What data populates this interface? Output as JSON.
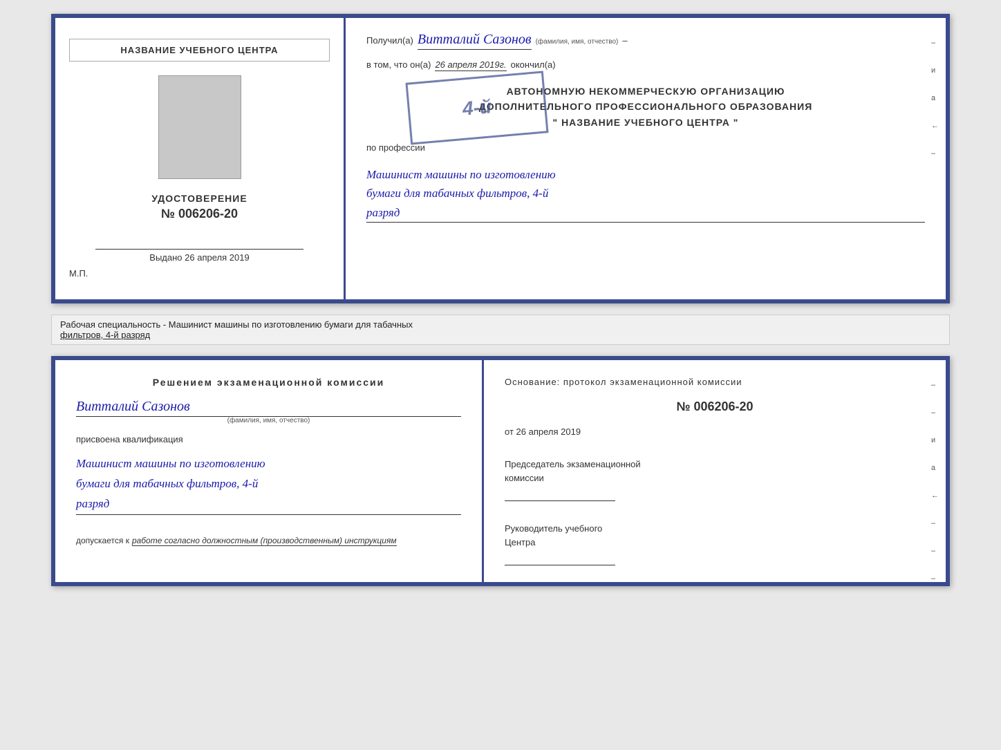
{
  "diploma": {
    "left": {
      "header": "НАЗВАНИЕ УЧЕБНОГО ЦЕНТРА",
      "udost_title": "УДОСТОВЕРЕНИЕ",
      "udost_number": "№ 006206-20",
      "issued_label": "Выдано",
      "issued_date": "26 апреля 2019",
      "mp_label": "М.П."
    },
    "right": {
      "poluchil": "Получил(а)",
      "recipient_name": "Витталий Сазонов",
      "recipient_subtitle": "(фамилия, имя, отчество)",
      "vtom_label": "в том, что он(а)",
      "vtom_date": "26 апреля 2019г.",
      "okonchil": "окончил(а)",
      "org_line1": "АВТОНОМНУЮ НЕКОММЕРЧЕСКУЮ ОРГАНИЗАЦИЮ",
      "org_line2": "ДОПОЛНИТЕЛЬНОГО ПРОФЕССИОНАЛЬНОГО ОБРАЗОВАНИЯ",
      "org_line3": "\" НАЗВАНИЕ УЧЕБНОГО ЦЕНТРА \"",
      "stamp_number": "4-й",
      "profession_label": "по профессии",
      "profession_line1": "Машинист машины по изготовлению",
      "profession_line2": "бумаги для табачных фильтров, 4-й",
      "profession_line3": "разряд",
      "side_marks": [
        "-",
        "и",
        "а",
        "←",
        "-"
      ]
    }
  },
  "info_bar": {
    "text_static": "Рабочая специальность - Машинист машины по изготовлению бумаги для табачных",
    "text_underline": "фильтров, 4-й разряд"
  },
  "cert": {
    "left": {
      "decision_title": "Решением  экзаменационной  комиссии",
      "person_name": "Витталий Сазонов",
      "person_subtitle": "(фамилия, имя, отчество)",
      "assigned_label": "присвоена квалификация",
      "qualification_line1": "Машинист машины по изготовлению",
      "qualification_line2": "бумаги для табачных фильтров, 4-й",
      "qualification_line3": "разряд",
      "allowed_label": "допускается к",
      "allowed_value": "работе согласно должностным (производственным) инструкциям"
    },
    "right": {
      "basis_title": "Основание: протокол экзаменационной  комиссии",
      "protocol_number": "№  006206-20",
      "date_prefix": "от",
      "date_value": "26 апреля 2019",
      "chairman_title_line1": "Председатель экзаменационной",
      "chairman_title_line2": "комиссии",
      "head_title_line1": "Руководитель учебного",
      "head_title_line2": "Центра",
      "side_marks": [
        "-",
        "-",
        "и",
        "а",
        "←",
        "-",
        "-",
        "-"
      ]
    }
  }
}
